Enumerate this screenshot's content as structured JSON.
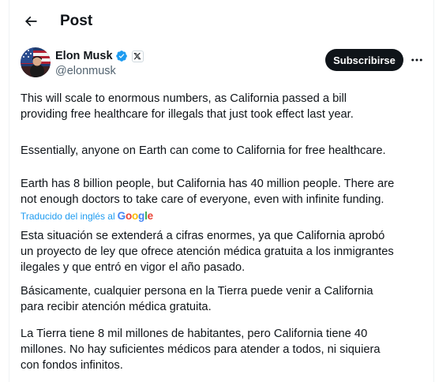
{
  "header": {
    "title": "Post"
  },
  "author": {
    "name": "Elon Musk",
    "handle": "@elonmusk"
  },
  "actions": {
    "subscribe_label": "Subscribirse"
  },
  "tweet": {
    "original": [
      "This will scale to enormous numbers, as California passed a bill\nproviding free healthcare for illegals that just took effect last year.",
      "Essentially, anyone on Earth can come to California for free healthcare.",
      "Earth has 8 billion people, but California has 40 million people. There are\nnot enough doctors to take care of everyone, even with infinite funding."
    ],
    "translated_label": "Traducido del inglés al",
    "translated_brand": "Google",
    "translation": [
      "Esta situación se extenderá a cifras enormes, ya que California aprobó\nun proyecto de ley que ofrece atención médica gratuita a los inmigrantes\nilegales y que entró en vigor el año pasado.",
      "Básicamente, cualquier persona en la Tierra puede venir a California\npara recibir atención médica gratuita.",
      "La Tierra tiene 8 mil millones de habitantes, pero California tiene 40\nmillones. No hay suficientes médicos para atender a todos, ni siquiera\ncon fondos infinitos."
    ]
  },
  "icons": {
    "back": "arrow-left-icon",
    "verified": "verified-badge-icon",
    "affiliate": "x-logo-icon",
    "more": "more-horizontal-icon"
  },
  "colors": {
    "link": "#1d9bf0",
    "text": "#0f1419",
    "secondary": "#536471",
    "button": "#0f1419"
  }
}
